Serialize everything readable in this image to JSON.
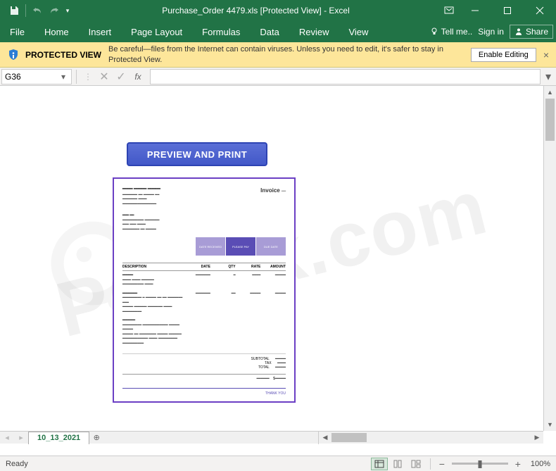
{
  "title": "Purchase_Order 4479.xls  [Protected View] - Excel",
  "qat": {
    "undo_available": false,
    "redo_available": false
  },
  "tabs": [
    "File",
    "Home",
    "Insert",
    "Page Layout",
    "Formulas",
    "Data",
    "Review",
    "View"
  ],
  "tell_me": "Tell me..",
  "sign_in": "Sign in",
  "share": "Share",
  "protected_view": {
    "title": "PROTECTED VIEW",
    "message": "Be careful—files from the Internet can contain viruses. Unless you need to edit, it's safer to stay in Protected View.",
    "button": "Enable Editing"
  },
  "name_box": "G36",
  "fx_label": "fx",
  "formula_value": "",
  "preview_button": "PREVIEW AND PRINT",
  "invoice": {
    "title": "Invoice",
    "boxes": [
      "DATE RECEIVED",
      "PLEASE PAY",
      "DUE DATE"
    ],
    "thead": [
      "DESCRIPTION",
      "DATE",
      "QTY",
      "RATE",
      "AMOUNT"
    ],
    "totals": [
      "SUBTOTAL",
      "TAX",
      "TOTAL"
    ],
    "thanks": "THANK YOU"
  },
  "sheet_tab": "10_13_2021",
  "status": {
    "ready": "Ready",
    "zoom": "100%"
  },
  "watermark": "PCrisk.com"
}
